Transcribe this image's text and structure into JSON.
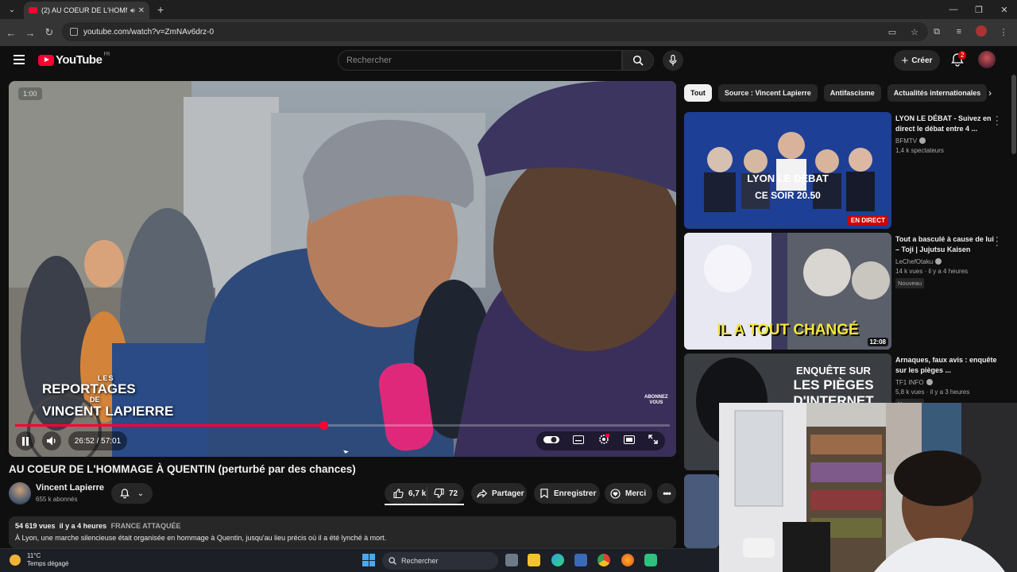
{
  "browser": {
    "tab_title": "(2) AU COEUR DE L'HOMMAGE À",
    "url": "youtube.com/watch?v=ZmNAv6drz-0"
  },
  "header": {
    "logo_text": "YouTube",
    "region": "FR",
    "search_placeholder": "Rechercher",
    "create_label": "Créer",
    "notifications_count": "2"
  },
  "video": {
    "time_card": "1:00",
    "time_display": "26:52 / 57:01",
    "progress_fraction": 0.4711,
    "watermark_line1": "LES",
    "watermark_line2": "REPORTAGES",
    "watermark_line3": "DE",
    "watermark_line4": "VINCENT LAPIERRE",
    "overlay_button_line1": "ABONNEZ",
    "overlay_button_line2": "VOUS"
  },
  "details": {
    "title": "AU COEUR DE L'HOMMAGE À QUENTIN (perturbé par des chances)",
    "channel_name": "Vincent Lapierre",
    "subscribers": "655 k abonnés",
    "likes": "6,7 k",
    "dislikes": "72",
    "share_label": "Partager",
    "save_label": "Enregistrer",
    "thanks_label": "Merci",
    "views": "54 619 vues",
    "published": "il y a 4 heures",
    "hashtag": "FRANCE ATTAQUÉE",
    "description": "À Lyon, une marche silencieuse était organisée en hommage à Quentin, jusqu'au lieu précis où il a été lynché à mort."
  },
  "chips": [
    "Tout",
    "Source : Vincent Lapierre",
    "Antifascisme",
    "Actualités internationales"
  ],
  "recommendations": [
    {
      "title": "LYON LE DÉBAT - Suivez en direct le débat entre 4 ...",
      "channel": "BFMTV",
      "meta": "1,4 k spectateurs",
      "badge": "EN DIRECT",
      "thumb_line1": "LYON LE DÉBAT",
      "thumb_line2": "CE SOIR 20.50"
    },
    {
      "title": "Tout a basculé à cause de lui – Toji | Jujutsu Kaisen",
      "channel": "LeChefOtaku",
      "meta": "14 k vues · il y a 4 heures",
      "badge": "Nouveau",
      "duration": "12:08",
      "thumb_line1": "IL A TOUT CHANGÉ"
    },
    {
      "title": "Arnaques, faux avis : enquête sur les pièges ...",
      "channel": "TF1 INFO",
      "meta": "5,8 k vues · il y a 3 heures",
      "badge": "Nouveau",
      "thumb_line1": "ENQUÊTE SUR",
      "thumb_line2": "LES PIÈGES",
      "thumb_line3": "D'INTERNET"
    }
  ],
  "taskbar": {
    "temperature": "11°C",
    "weather": "Temps dégagé",
    "search_label": "Rechercher"
  },
  "colors": {
    "accent_red": "#ff0033",
    "background": "#0f0f0f",
    "surface": "#272727"
  }
}
